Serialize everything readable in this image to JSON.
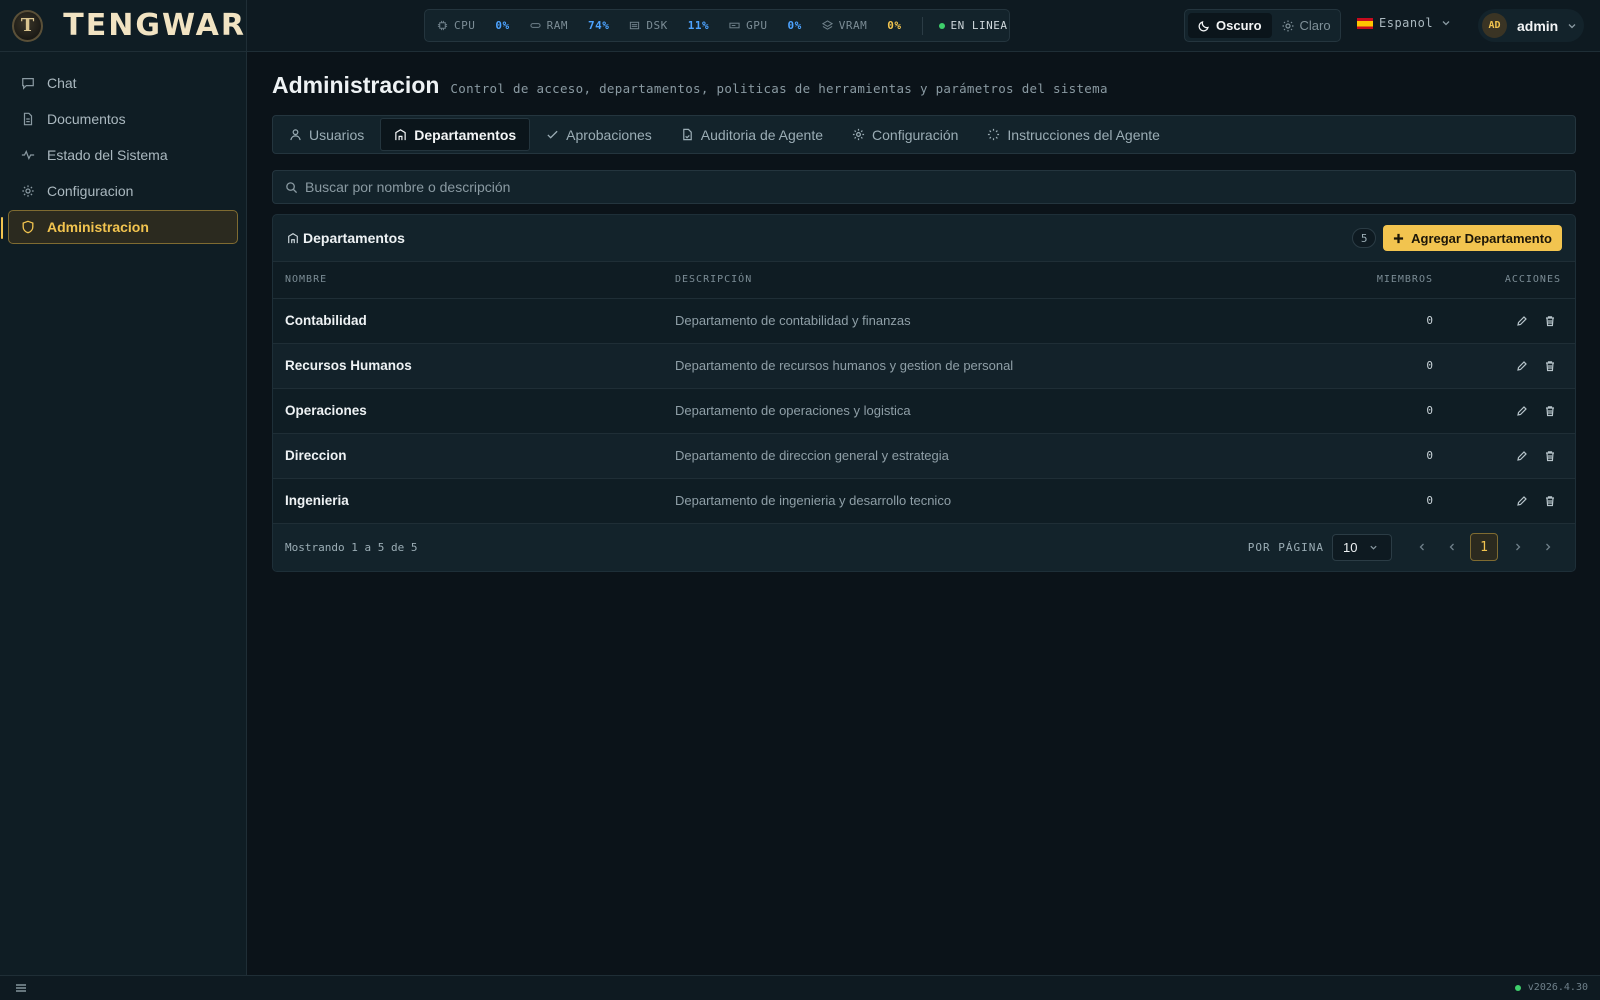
{
  "app": {
    "brand": "TENGWAR",
    "logo_glyph": "T"
  },
  "sidebar": {
    "items": [
      {
        "label": "Chat",
        "icon": "chat-icon"
      },
      {
        "label": "Documentos",
        "icon": "document-icon"
      },
      {
        "label": "Estado del Sistema",
        "icon": "activity-icon"
      },
      {
        "label": "Configuracion",
        "icon": "gear-icon"
      },
      {
        "label": "Administracion",
        "icon": "shield-icon",
        "active": true
      }
    ]
  },
  "topbar": {
    "metrics": [
      {
        "label": "CPU",
        "value": "0%",
        "icon": "cpu-icon"
      },
      {
        "label": "RAM",
        "value": "74%",
        "icon": "ram-icon"
      },
      {
        "label": "DSK",
        "value": "11%",
        "icon": "disk-icon"
      },
      {
        "label": "GPU",
        "value": "0%",
        "icon": "gpu-icon"
      },
      {
        "label": "VRAM",
        "value": "0%",
        "icon": "layers-icon"
      }
    ],
    "status": "EN LINEA",
    "theme": {
      "dark": "Oscuro",
      "light": "Claro",
      "selected": "Oscuro"
    },
    "language": "Espanol",
    "user": {
      "initials": "AD",
      "name": "admin"
    }
  },
  "page": {
    "title": "Administracion",
    "subtitle": "Control de acceso, departamentos, politicas de herramientas y parámetros del sistema",
    "tabs": [
      {
        "label": "Usuarios",
        "icon": "user-icon"
      },
      {
        "label": "Departamentos",
        "icon": "building-icon",
        "active": true
      },
      {
        "label": "Aprobaciones",
        "icon": "check-icon"
      },
      {
        "label": "Auditoria de Agente",
        "icon": "file-audit-icon"
      },
      {
        "label": "Configuración",
        "icon": "gear-icon"
      },
      {
        "label": "Instrucciones del Agente",
        "icon": "loader-icon"
      }
    ],
    "search_placeholder": "Buscar por nombre o descripción"
  },
  "panel": {
    "title": "Departamentos",
    "count": "5",
    "add_label": "Agregar Departamento",
    "columns": {
      "name": "NOMBRE",
      "description": "DESCRIPCIÓN",
      "members": "MIEMBROS",
      "actions": "ACCIONES"
    },
    "rows": [
      {
        "name": "Contabilidad",
        "description": "Departamento de contabilidad y finanzas",
        "members": "0"
      },
      {
        "name": "Recursos Humanos",
        "description": "Departamento de recursos humanos y gestion de personal",
        "members": "0"
      },
      {
        "name": "Operaciones",
        "description": "Departamento de operaciones y logistica",
        "members": "0"
      },
      {
        "name": "Direccion",
        "description": "Departamento de direccion general y estrategia",
        "members": "0"
      },
      {
        "name": "Ingenieria",
        "description": "Departamento de ingenieria y desarrollo tecnico",
        "members": "0"
      }
    ],
    "footer": {
      "info": "Mostrando 1 a 5 de 5",
      "per_page_label": "POR PÁGINA",
      "per_page_value": "10",
      "current_page": "1"
    }
  },
  "bottombar": {
    "version": "v2026.4.30"
  },
  "colors": {
    "accent": "#f2c44f",
    "metric_value": "#4da3ff",
    "online": "#3ecf6b",
    "background": "#0b1319"
  }
}
